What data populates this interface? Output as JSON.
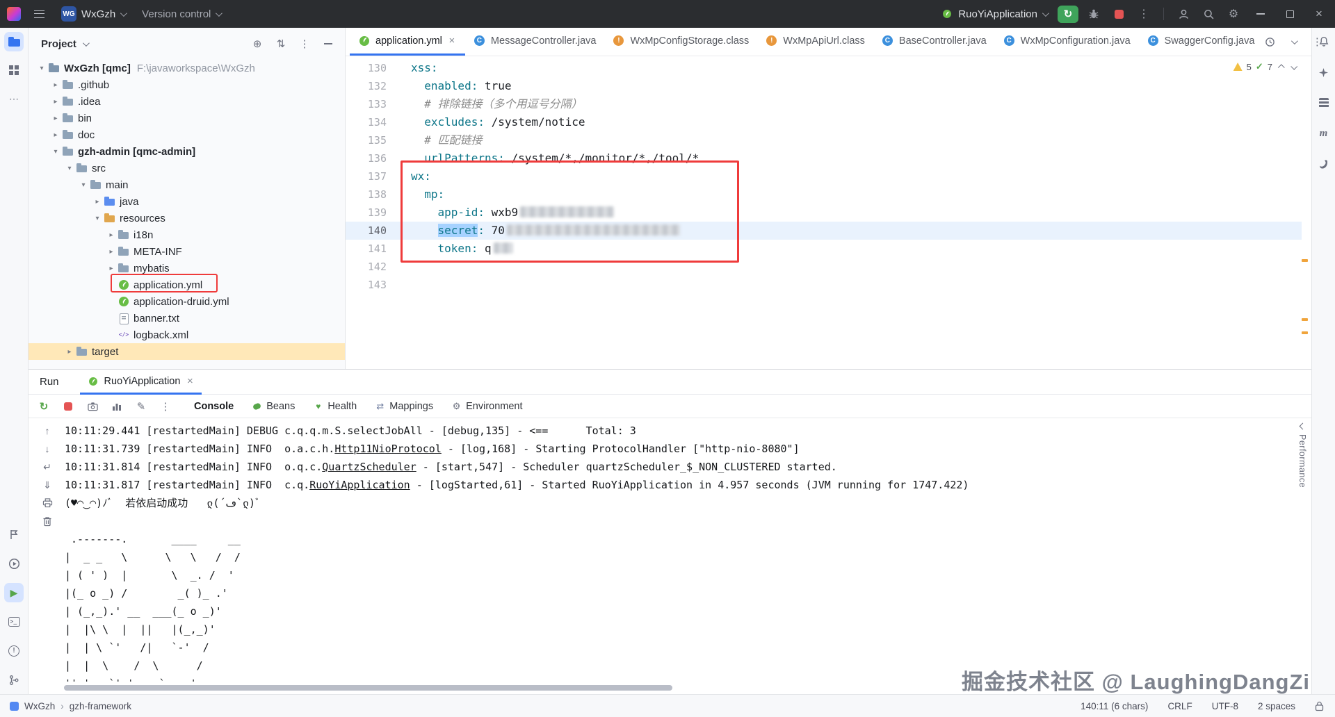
{
  "titlebar": {
    "logo_text": "WG",
    "project_name": "WxGzh",
    "version_control_label": "Version control",
    "run_config_name": "RuoYiApplication"
  },
  "project_panel": {
    "title": "Project",
    "tree": [
      {
        "label": "WxGzh [qmc]",
        "sub": "F:\\javaworkspace\\WxGzh",
        "level": 0,
        "chev": "down",
        "icon": "project-folder",
        "bold": true
      },
      {
        "label": ".github",
        "level": 1,
        "chev": "right",
        "icon": "folder"
      },
      {
        "label": ".idea",
        "level": 1,
        "chev": "right",
        "icon": "folder"
      },
      {
        "label": "bin",
        "level": 1,
        "chev": "right",
        "icon": "folder"
      },
      {
        "label": "doc",
        "level": 1,
        "chev": "right",
        "icon": "folder"
      },
      {
        "label": "gzh-admin [qmc-admin]",
        "level": 1,
        "chev": "down",
        "icon": "folder",
        "bold": true
      },
      {
        "label": "src",
        "level": 2,
        "chev": "down",
        "icon": "folder"
      },
      {
        "label": "main",
        "level": 3,
        "chev": "down",
        "icon": "folder"
      },
      {
        "label": "java",
        "level": 4,
        "chev": "right",
        "icon": "folder-java"
      },
      {
        "label": "resources",
        "level": 4,
        "chev": "down",
        "icon": "folder-res"
      },
      {
        "label": "i18n",
        "level": 5,
        "chev": "right",
        "icon": "folder"
      },
      {
        "label": "META-INF",
        "level": 5,
        "chev": "right",
        "icon": "folder"
      },
      {
        "label": "mybatis",
        "level": 5,
        "chev": "right",
        "icon": "folder"
      },
      {
        "label": "application.yml",
        "level": 5,
        "icon": "spring",
        "annotated": true
      },
      {
        "label": "application-druid.yml",
        "level": 5,
        "icon": "spring"
      },
      {
        "label": "banner.txt",
        "level": 5,
        "icon": "txt"
      },
      {
        "label": "logback.xml",
        "level": 5,
        "icon": "xml"
      },
      {
        "label": "target",
        "level": 2,
        "chev": "right",
        "icon": "folder",
        "highlight": true
      }
    ]
  },
  "editor": {
    "tabs": [
      {
        "label": "application.yml",
        "icon": "spring",
        "active": true
      },
      {
        "label": "MessageController.java",
        "icon": "class"
      },
      {
        "label": "WxMpConfigStorage.class",
        "icon": "class-warn"
      },
      {
        "label": "WxMpApiUrl.class",
        "icon": "class-warn"
      },
      {
        "label": "BaseController.java",
        "icon": "class"
      },
      {
        "label": "WxMpConfiguration.java",
        "icon": "class"
      },
      {
        "label": "SwaggerConfig.java",
        "icon": "class"
      }
    ],
    "inspections": {
      "warnings": "5",
      "passed": "7"
    },
    "code": [
      {
        "num": "130",
        "segs": [
          [
            "k",
            "xss:"
          ]
        ]
      },
      {
        "num": "132",
        "segs": [
          [
            "v",
            "  "
          ],
          [
            "k",
            "enabled:"
          ],
          [
            "v",
            " true"
          ]
        ]
      },
      {
        "num": "133",
        "segs": [
          [
            "v",
            "  "
          ],
          [
            "c",
            "# 排除链接（多个用逗号分隔）"
          ]
        ]
      },
      {
        "num": "134",
        "segs": [
          [
            "v",
            "  "
          ],
          [
            "k",
            "excludes:"
          ],
          [
            "v",
            " /system/notice"
          ]
        ]
      },
      {
        "num": "135",
        "segs": [
          [
            "v",
            "  "
          ],
          [
            "c",
            "# 匹配链接"
          ]
        ]
      },
      {
        "num": "136",
        "segs": [
          [
            "v",
            "  "
          ],
          [
            "k",
            "urlPatterns:"
          ],
          [
            "v",
            " /system/*,/monitor/*,/tool/*"
          ]
        ]
      },
      {
        "num": "137",
        "segs": [
          [
            "k",
            "wx:"
          ]
        ]
      },
      {
        "num": "138",
        "segs": [
          [
            "v",
            "  "
          ],
          [
            "k",
            "mp:"
          ]
        ]
      },
      {
        "num": "139",
        "segs": [
          [
            "v",
            "    "
          ],
          [
            "k",
            "app-id:"
          ],
          [
            "v",
            " wxb9"
          ],
          [
            "r",
            "14"
          ]
        ]
      },
      {
        "num": "140",
        "current": true,
        "segs": [
          [
            "v",
            "    "
          ],
          [
            "sel",
            "secret"
          ],
          [
            "k",
            ":"
          ],
          [
            "v",
            " 70"
          ],
          [
            "r",
            "26"
          ]
        ]
      },
      {
        "num": "141",
        "segs": [
          [
            "v",
            "    "
          ],
          [
            "k",
            "token:"
          ],
          [
            "v",
            " q"
          ],
          [
            "r",
            "3"
          ]
        ]
      },
      {
        "num": "142",
        "segs": []
      },
      {
        "num": "143",
        "segs": []
      }
    ]
  },
  "run_panel": {
    "title": "Run",
    "tab_label": "RuoYiApplication",
    "toolbar_tabs": [
      {
        "label": "Console",
        "icon": "",
        "active": true
      },
      {
        "label": "Beans",
        "icon": "bean"
      },
      {
        "label": "Health",
        "icon": "health"
      },
      {
        "label": "Mappings",
        "icon": "mappings"
      },
      {
        "label": "Environment",
        "icon": "environment"
      }
    ],
    "side_tab": "Performance",
    "console": [
      [
        [
          "p",
          "10:11:29.441 [restartedMain] DEBUG c.q.q.m.S.selectJobAll - [debug,135] - <==      Total: 3"
        ]
      ],
      [
        [
          "p",
          "10:11:31.739 [restartedMain] INFO  o.a.c.h."
        ],
        [
          "l",
          "Http11NioProtocol"
        ],
        [
          "p",
          " - [log,168] - Starting ProtocolHandler [\"http-nio-8080\"]"
        ]
      ],
      [
        [
          "p",
          "10:11:31.814 [restartedMain] INFO  o.q.c."
        ],
        [
          "l",
          "QuartzScheduler"
        ],
        [
          "p",
          " - [start,547] - Scheduler quartzScheduler_$_NON_CLUSTERED started."
        ]
      ],
      [
        [
          "p",
          "10:11:31.817 [restartedMain] INFO  c.q."
        ],
        [
          "l",
          "RuoYiApplication"
        ],
        [
          "p",
          " - [logStarted,61] - Started RuoYiApplication in 4.957 seconds (JVM running for 1747.422)"
        ]
      ],
      [
        [
          "p",
          "(♥◠‿◠)ﾉﾞ  若依启动成功   ლ(´ڡ`ლ)ﾞ"
        ]
      ],
      [
        [
          "p",
          ""
        ]
      ],
      [
        [
          "p",
          " .-------.       ____     __"
        ]
      ],
      [
        [
          "p",
          "|  _ _   \\      \\   \\   /  /"
        ]
      ],
      [
        [
          "p",
          "| ( ' )  |       \\  _. /  '"
        ]
      ],
      [
        [
          "p",
          "|(_ o _) /        _( )_ .'"
        ]
      ],
      [
        [
          "p",
          "| (_,_).' __  ___(_ o _)'"
        ]
      ],
      [
        [
          "p",
          "|  |\\ \\  |  ||   |(_,_)'"
        ]
      ],
      [
        [
          "p",
          "|  | \\ `'   /|   `-'  /"
        ]
      ],
      [
        [
          "p",
          "|  |  \\    /  \\      /"
        ]
      ],
      [
        [
          "p",
          "''-'   `'-'    `-..-'"
        ]
      ]
    ]
  },
  "status_bar": {
    "breadcrumb": [
      "WxGzh",
      "gzh-framework"
    ],
    "caret_info": "140:11 (6 chars)",
    "line_separator": "CRLF",
    "encoding": "UTF-8",
    "indent": "2 spaces"
  },
  "watermark": "掘金技术社区 @ LaughingDangZi",
  "icons": {
    "menu-icon": "hamburger-bars",
    "search-icon": "magnifier",
    "settings-icon": "gear ⚙",
    "user-icon": "person-silhouette",
    "minimize-icon": "dash",
    "maximize-icon": "square-outline",
    "close-icon": "cross ×",
    "rerun-icon": "circular-arrow ↻",
    "debug-icon": "bug",
    "stop-icon": "red-square",
    "spring-icon": "green-leaf",
    "warning-icon": "yellow-triangle",
    "ok-check-icon": "green-check ✓",
    "notifications-icon": "bell",
    "database-icon": "stacked-disks",
    "maven-icon": "letter-m",
    "lock-icon": "padlock",
    "print-icon": "printer",
    "clear-icon": "trash-can"
  }
}
